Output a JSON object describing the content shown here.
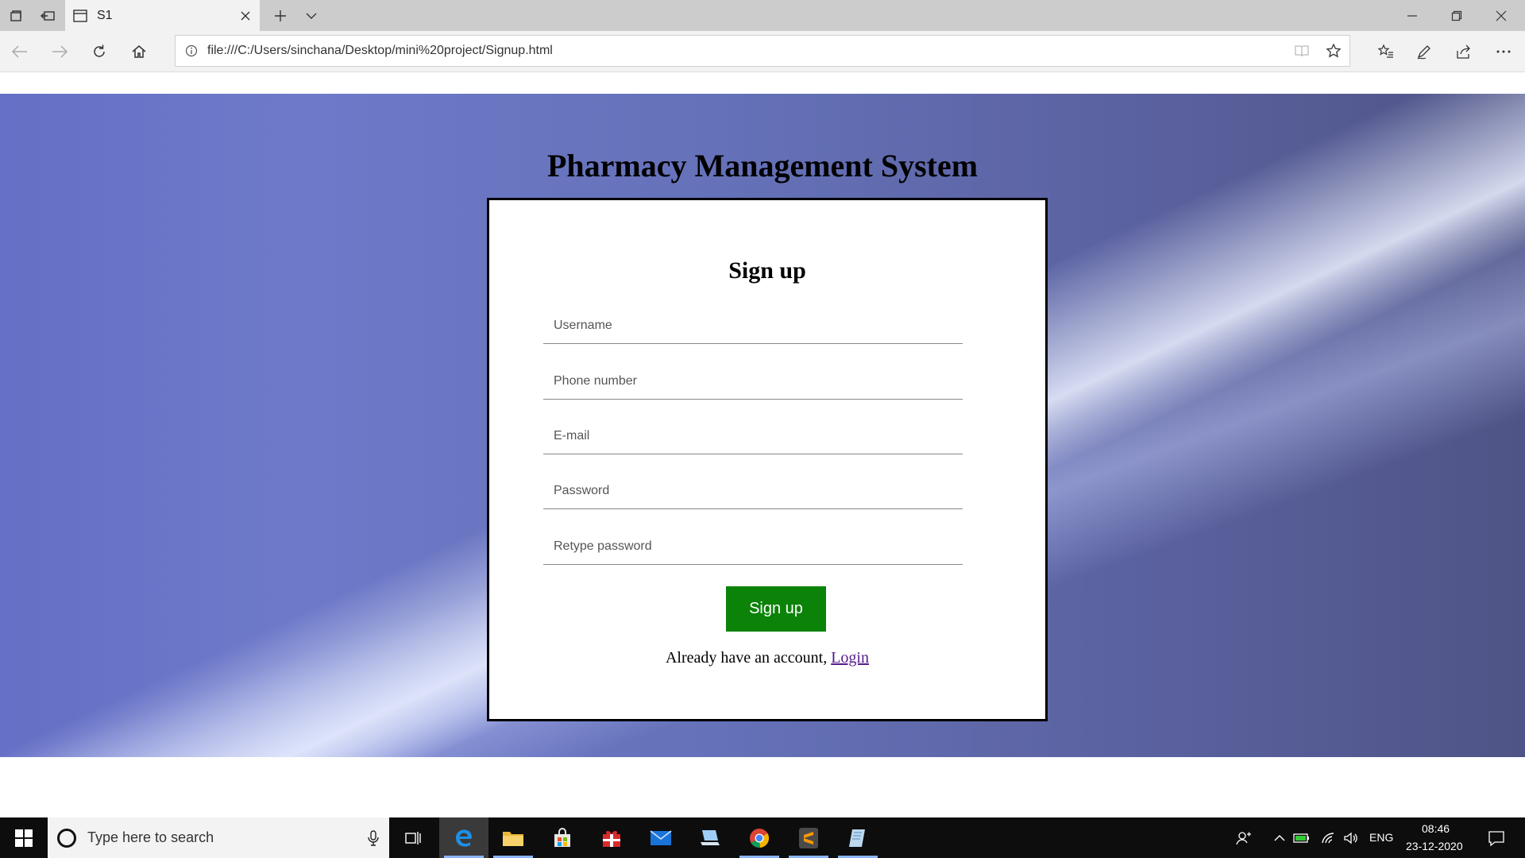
{
  "browser": {
    "tab_title": "S1",
    "address_url": "file:///C:/Users/sinchana/Desktop/mini%20project/Signup.html"
  },
  "page": {
    "title": "Pharmacy Management System",
    "form": {
      "heading": "Sign up",
      "fields": [
        {
          "placeholder": "Username"
        },
        {
          "placeholder": "Phone number"
        },
        {
          "placeholder": "E-mail"
        },
        {
          "placeholder": "Password"
        },
        {
          "placeholder": "Retype password"
        }
      ],
      "submit_label": "Sign up",
      "login_prompt": "Already have an account,",
      "login_link": "Login"
    }
  },
  "taskbar": {
    "search_placeholder": "Type here to search",
    "language": "ENG",
    "time": "08:46",
    "date": "23-12-2020"
  },
  "colors": {
    "submit_button": "#0b8208",
    "login_link": "#551a8b",
    "background_left": "#6570c6",
    "background_right": "#4f5486"
  }
}
